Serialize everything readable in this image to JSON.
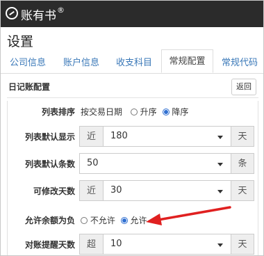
{
  "app": {
    "name": "账有书",
    "mark": "®"
  },
  "page": {
    "title": "设置"
  },
  "tabs": [
    "公司信息",
    "账户信息",
    "收支科目",
    "常规配置",
    "常规代码"
  ],
  "active_tab": "常规配置",
  "section": {
    "title": "日记账配置",
    "back_label": "返回"
  },
  "fields": {
    "list_sort": {
      "label": "列表排序",
      "prefix_text": "按交易日期",
      "options": [
        "升序",
        "降序"
      ],
      "selected": "降序"
    },
    "default_display": {
      "label": "列表默认显示",
      "prefix": "近",
      "value": "180",
      "suffix": "天"
    },
    "default_count": {
      "label": "列表默认条数",
      "value": "50",
      "suffix": "条"
    },
    "editable_days": {
      "label": "可修改天数",
      "prefix": "近",
      "value": "30",
      "suffix": "天"
    },
    "allow_negative": {
      "label": "允许余额为负",
      "options": [
        "不允许",
        "允许"
      ],
      "selected": "允许"
    },
    "reconcile_reminder": {
      "label": "对账提醒天数",
      "prefix": "超",
      "value": "10",
      "suffix": "天"
    }
  },
  "colors": {
    "topbar": "#2b2b2b",
    "tab_link": "#3a78b8",
    "radio_checked": "#2f6fd1",
    "arrow": "#e02020"
  }
}
